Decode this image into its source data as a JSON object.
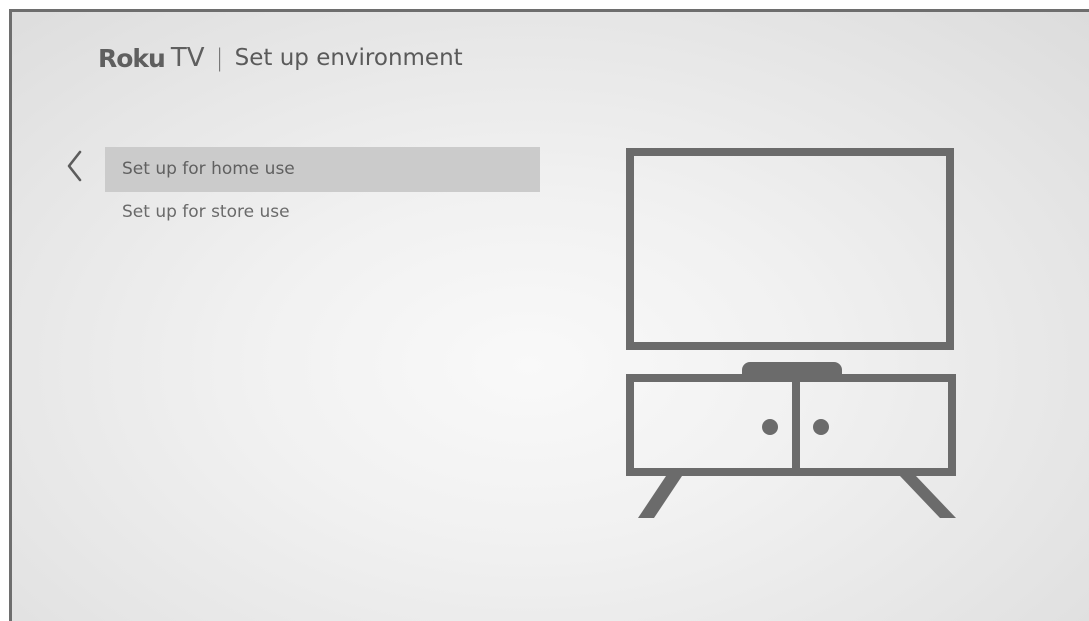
{
  "header": {
    "brand_name": "Roku",
    "brand_suffix": "TV",
    "separator": "|",
    "title": "Set up environment"
  },
  "navigation": {
    "back_icon": "chevron-left-icon"
  },
  "menu": {
    "items": [
      {
        "label": "Set up for home use",
        "selected": true
      },
      {
        "label": "Set up for store use",
        "selected": false
      }
    ]
  },
  "illustration": {
    "icon": "tv-on-stand-illustration"
  },
  "colors": {
    "background": "#eeeeee",
    "selected_row": "#cbcbcb",
    "text": "#666666",
    "illustration_stroke": "#6b6b6b"
  }
}
